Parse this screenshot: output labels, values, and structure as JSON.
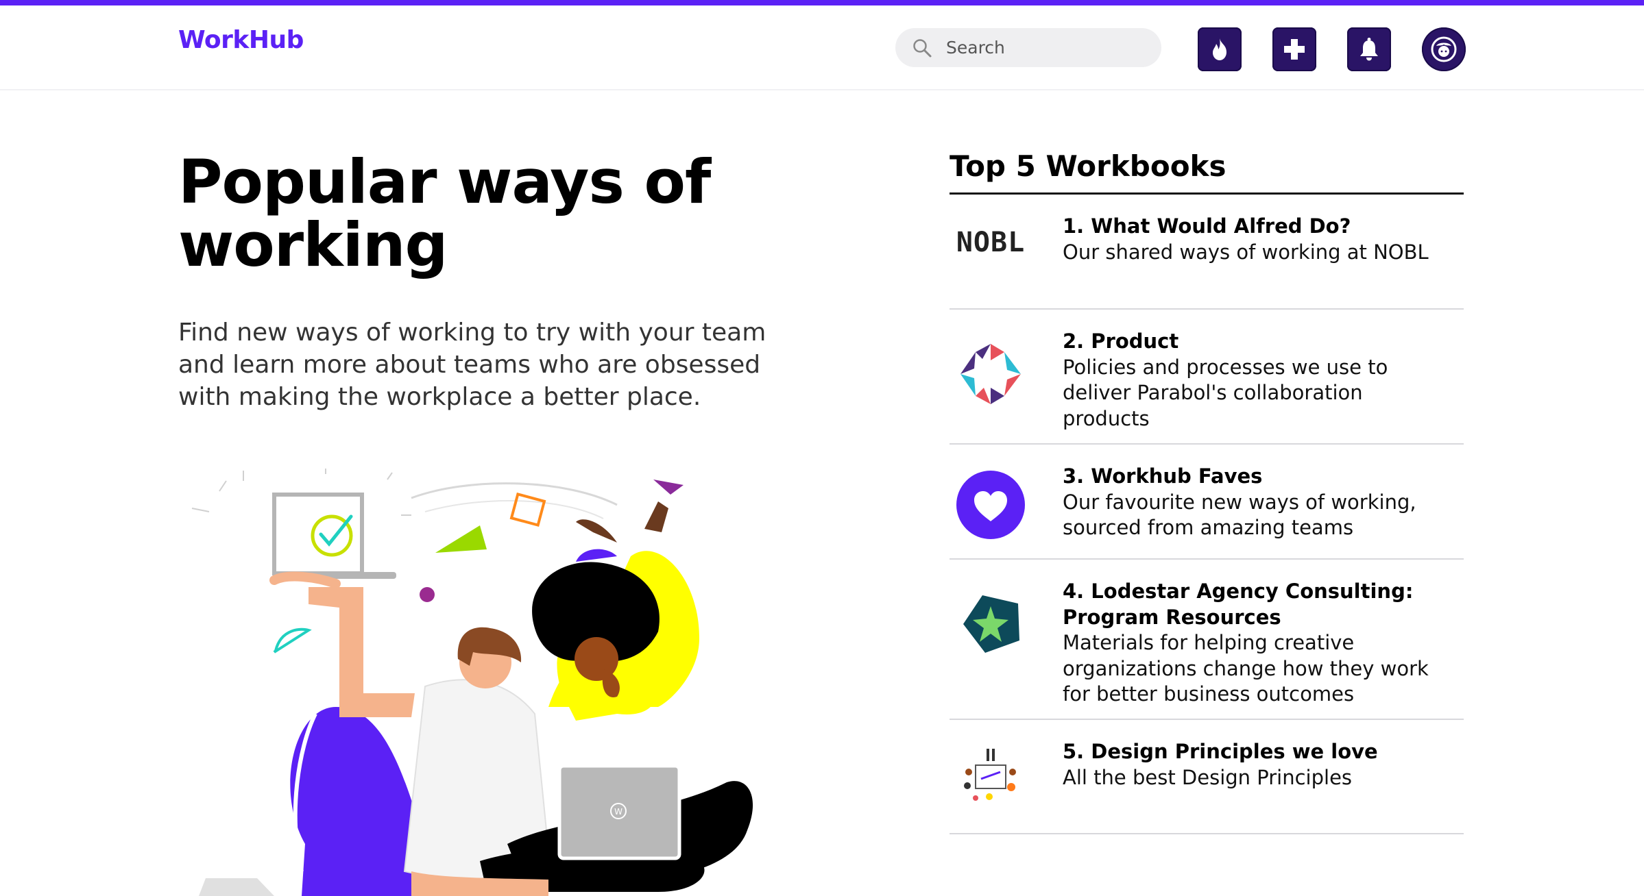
{
  "header": {
    "logo": "WorkHub",
    "search_placeholder": "Search",
    "icons": [
      "flame-icon",
      "plus-icon",
      "bell-icon",
      "avatar-icon"
    ]
  },
  "hero": {
    "title": "Popular ways of working",
    "subtitle": "Find new ways of working to try with your team and learn more about teams who are obsessed with making the workplace a better place."
  },
  "illustration": {
    "laptop_badge": "W"
  },
  "top_workbooks": {
    "title": "Top 5 Workbooks",
    "items": [
      {
        "title": "1. What Would Alfred Do?",
        "description": "Our shared ways of working at NOBL",
        "logo": "NOBL"
      },
      {
        "title": "2. Product",
        "description": "Policies and processes we use to deliver Parabol's collaboration products",
        "logo": "parabol-logo"
      },
      {
        "title": "3. Workhub Faves",
        "description": "Our favourite new ways of working, sourced from amazing teams",
        "logo": "heart-logo"
      },
      {
        "title": "4. Lodestar Agency Consulting: Program Resources",
        "description": "Materials for helping creative organizations change how they work for better business outcomes",
        "logo": "star-logo"
      },
      {
        "title": "5. Design Principles we love",
        "description": "All the best Design Principles",
        "logo": "doodle-logo"
      }
    ]
  },
  "colors": {
    "brand": "#5b21f5",
    "header_button": "#2a1466",
    "search_bg": "#efeff1"
  }
}
